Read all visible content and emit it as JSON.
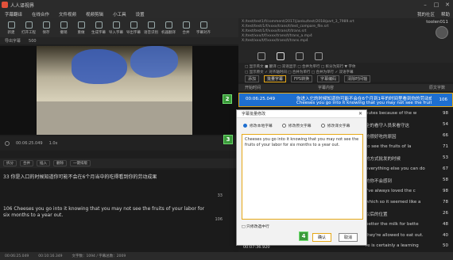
{
  "app": {
    "title": "人人译视界"
  },
  "menu": [
    "字幕翻译",
    "在线合作",
    "文件视频",
    "视频剪辑",
    "小工具",
    "设置"
  ],
  "menu_right": {
    "community": "我的社区",
    "help": "帮助"
  },
  "user": {
    "name": "toolen011"
  },
  "toolbar": [
    "新建",
    "打开工程",
    "保存",
    "撤销",
    "重做",
    "生成字幕",
    "导入字幕",
    "导出字幕",
    "语音识别",
    "机器翻译",
    "合并",
    "字幕对齐"
  ],
  "subbar": {
    "label": "导出字幕",
    "fontsize": "500"
  },
  "transport": {
    "time": "00:06:25.049",
    "speed": "1.0x"
  },
  "edit_tools": [
    "拆分",
    "合并",
    "插入",
    "删除",
    "一键排版"
  ],
  "line_editor": {
    "line1": "33 你是入口的时候知道你可能不会在6个月当中的吃得看到你的劳动成果",
    "line2": "106 Cheeses you go into it knowing that you may not see the fruits of your labor for six months to a year out.",
    "count1": "33",
    "count2": "106"
  },
  "file_list": [
    "X:/test/test1/f/comment/2017/jianku/test/2018/part_3_7989.srt",
    "X:/test/test/1/f/xxxx/trans/t/test_compare_file.srt",
    "X:/test/test/1/f/xxxx/trans/t/trans.srt",
    "X:/test/xxx/t/f/xxxx/trans/t/trans_a.mp4",
    "X:/test/xxx/t/f/xxxx/trans/t/trans.mp4"
  ],
  "right_options": {
    "line1": "□ 显示英文  ■ 翻译  □ 双语显示  □ 合并为单行  □ 拆分为双行  ▼ 字体",
    "line2": "□ 显示原文  ✓ 对齐轴时间  □ 合并为单行  □ 合并为单行  ✓ 双语字幕"
  },
  "right_buttons": {
    "add": "添加",
    "batch": "批量字幕",
    "fps": "FPS转换",
    "encode": "字幕编码",
    "clear": "清除时间轴"
  },
  "table_head": {
    "time": "开始时间",
    "text": "字幕内容",
    "count": "原文字数"
  },
  "selected_row": {
    "time": "00:06:25.049",
    "cn": "你进入它的时候知道你可能不会在6个月到1年的时间里看到你的劳动成果",
    "en": "Cheeses you go into it knowing that you may not see the fruits of",
    "count": "106"
  },
  "rows": [
    {
      "text": "nutes because of the w",
      "count": "98"
    },
    {
      "text": "全的看守人员来看守这",
      "count": "54"
    },
    {
      "text": "的很好吃的原因",
      "count": "66"
    },
    {
      "text": "to see the fruits of la",
      "count": "71"
    },
    {
      "text": "的方式批发的时候",
      "count": "53"
    },
    {
      "text": "everything else you can do",
      "count": "67"
    },
    {
      "text": "的你不会感到",
      "count": "58"
    },
    {
      "text": "I've always loved the c",
      "count": "98"
    },
    {
      "text": "which so it seemed like a",
      "count": "78"
    },
    {
      "text": "以后的位置",
      "count": "26"
    },
    {
      "text": "better the milk for bette",
      "count": "48"
    },
    {
      "text": "they're allowed to eat out.",
      "count": "40"
    },
    {
      "text": "re is certainly a learning",
      "count": "50"
    }
  ],
  "dialog": {
    "title": "字幕批量修改",
    "radio1": "修改本地字幕",
    "radio2": "修改原文字幕",
    "radio3": "修改译文字幕",
    "text": "Cheeses you go into it knowing that you may not see the fruits of your labor for six months to a year out.",
    "checkbox": "□ 只修改选中行",
    "ok": "确认",
    "cancel": "取消"
  },
  "markers": [
    "1",
    "2",
    "3",
    "4"
  ],
  "bottom_time": "00:07:36.920",
  "status": {
    "left": "00:06:25.049",
    "mid": "00:10:16.349",
    "words": "文字数：1094 / 字幕总数：2009"
  },
  "colors": {
    "accent": "#1e6fd0",
    "highlight": "#e6a817",
    "marker": "#3a9a3a"
  }
}
